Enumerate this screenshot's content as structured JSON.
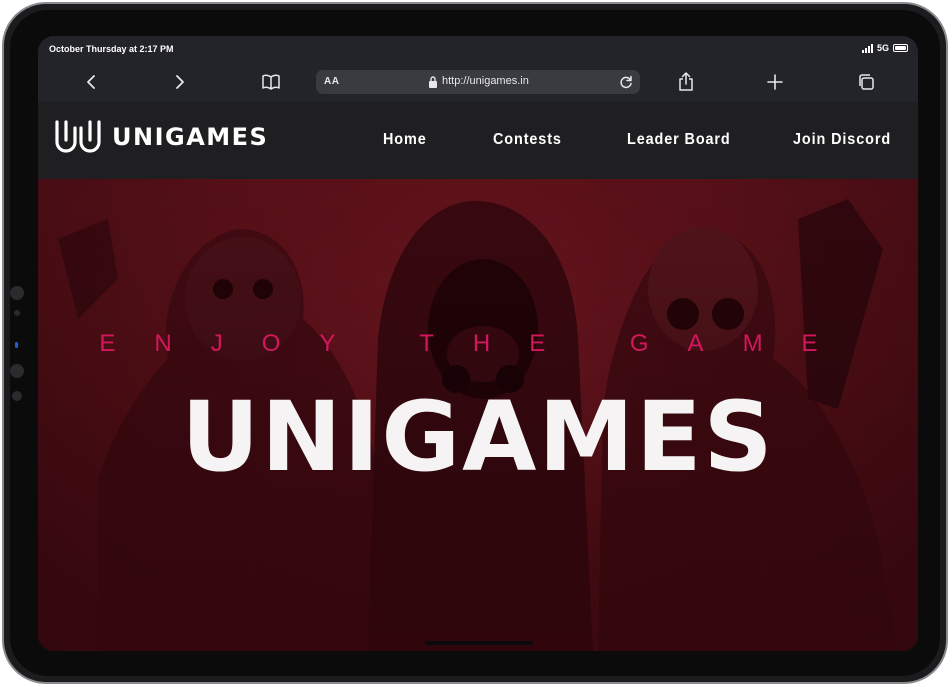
{
  "status": {
    "time": "October Thursday at 2:17 PM",
    "network": "5G"
  },
  "toolbar": {
    "icons": [
      "back-icon",
      "forward-icon",
      "bookmarks-icon",
      "share-icon",
      "new-tab-icon",
      "tabs-icon"
    ]
  },
  "urlbar": {
    "reader_label": "AA",
    "url": "http://unigames.in"
  },
  "site": {
    "logo_text": "UNIGAMES",
    "nav": [
      "Home",
      "Contests",
      "Leader Board",
      "Join Discord"
    ]
  },
  "hero": {
    "tagline": "ENJOY THE GAME",
    "title": "UNIGAMES"
  },
  "colors": {
    "accent": "#d4175d",
    "hero_bg": "#5e1119",
    "header_bg": "#1f1f22"
  }
}
